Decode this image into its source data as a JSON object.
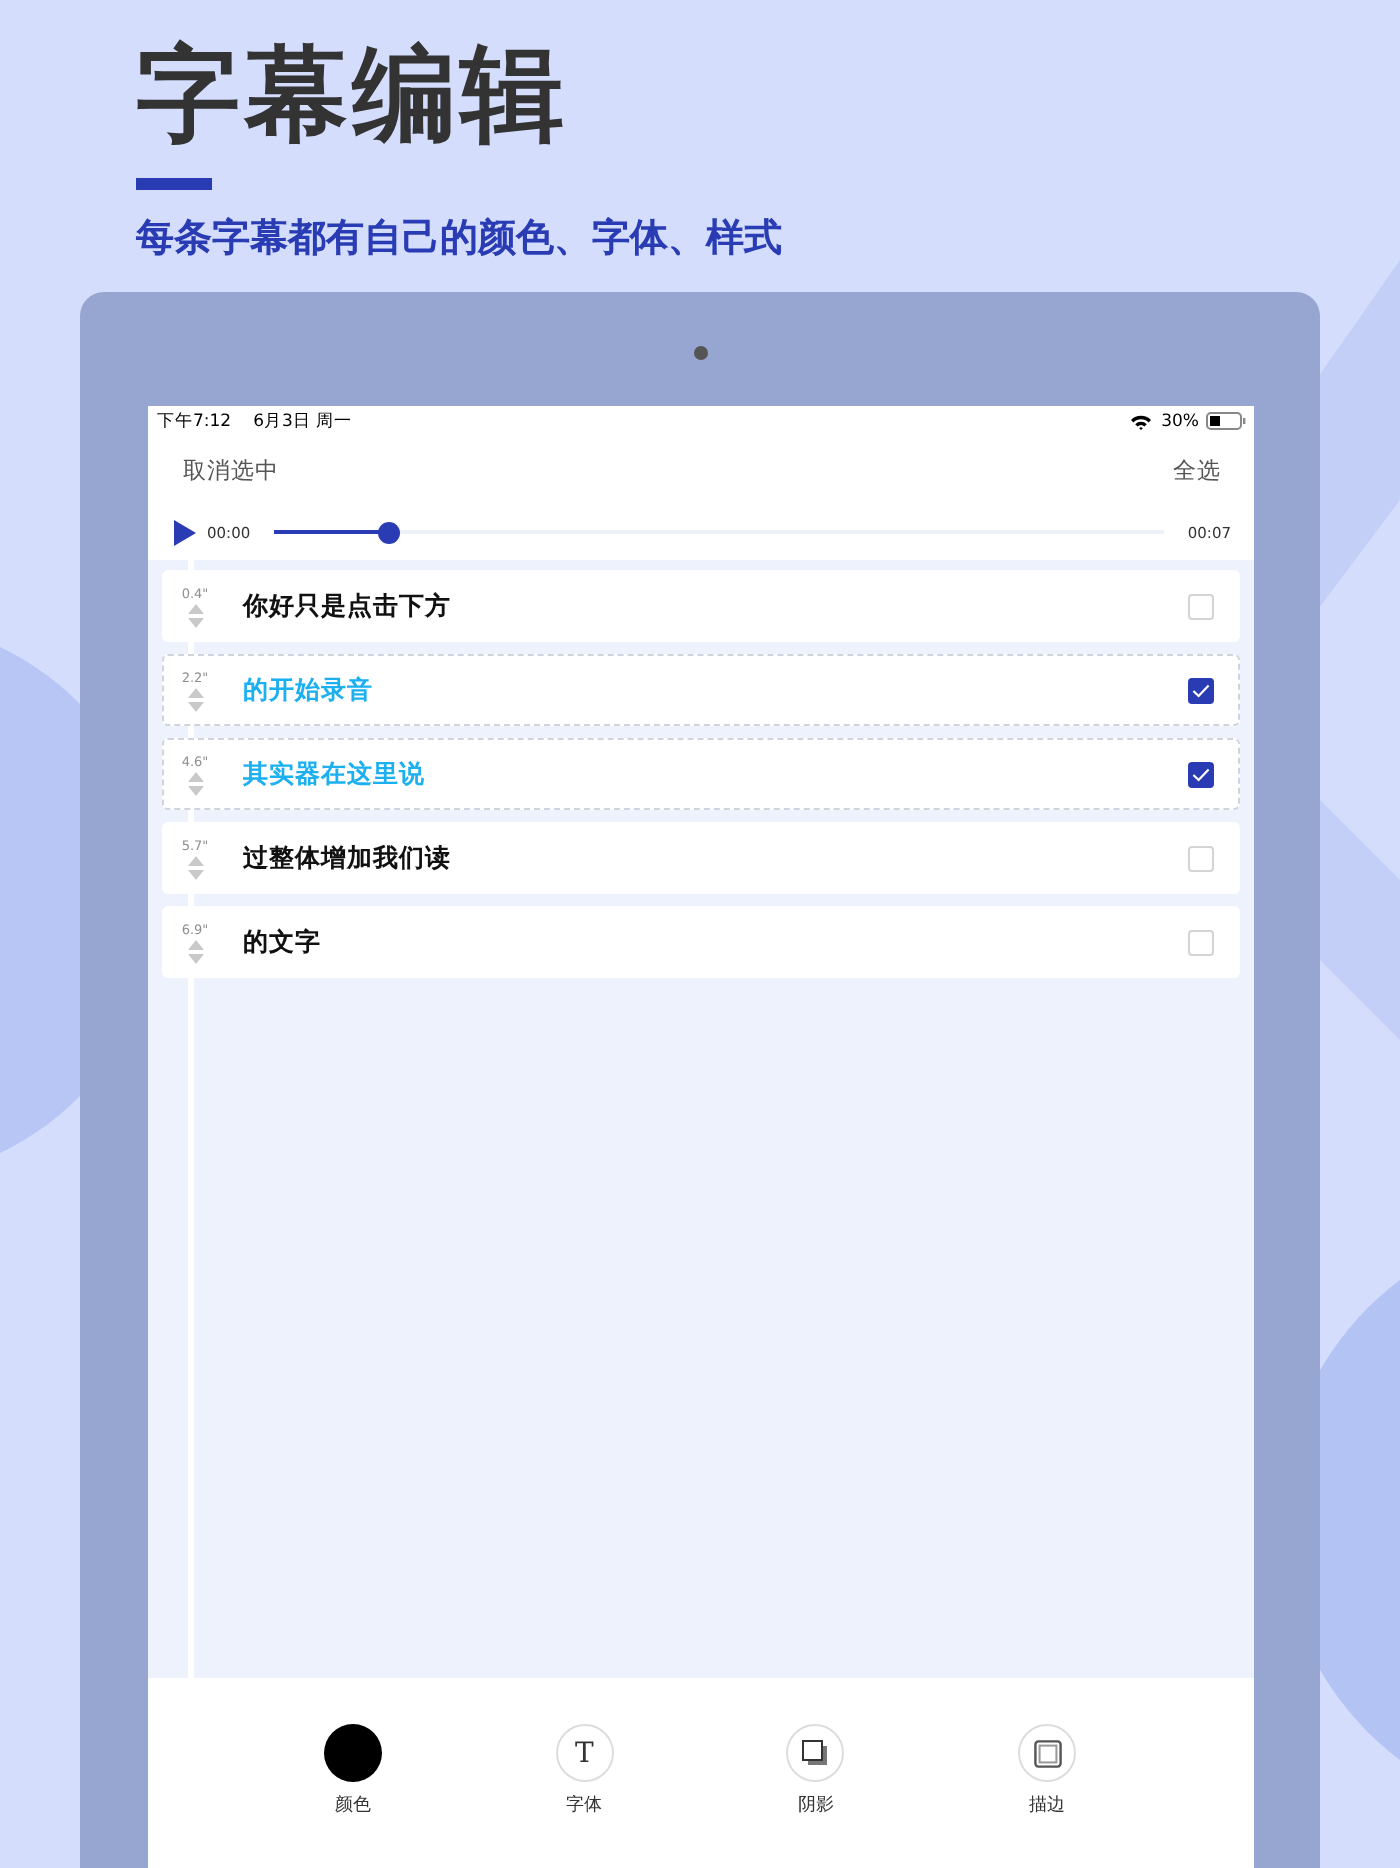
{
  "headline": "字幕编辑",
  "subtitle": "每条字幕都有自己的颜色、字体、样式",
  "status_bar": {
    "time": "下午7:12",
    "date": "6月3日 周一",
    "battery": "30%"
  },
  "header": {
    "left": "取消选中",
    "right": "全选"
  },
  "player": {
    "start": "00:00",
    "end": "00:07",
    "level": 0.13
  },
  "subtitles": [
    {
      "time": "0.4\"",
      "text": "你好只是点击下方",
      "checked": false
    },
    {
      "time": "2.2\"",
      "text": "的开始录音",
      "checked": true
    },
    {
      "time": "4.6\"",
      "text": "其实器在这里说",
      "checked": true
    },
    {
      "time": "5.7\"",
      "text": "过整体增加我们读",
      "checked": false
    },
    {
      "time": "6.9\"",
      "text": "的文字",
      "checked": false
    }
  ],
  "toolbar": [
    {
      "kind": "color",
      "label": "颜色",
      "color": "#000000"
    },
    {
      "kind": "font",
      "label": "字体",
      "glyph": "T"
    },
    {
      "kind": "shadow",
      "label": "阴影"
    },
    {
      "kind": "stroke",
      "label": "描边"
    }
  ]
}
